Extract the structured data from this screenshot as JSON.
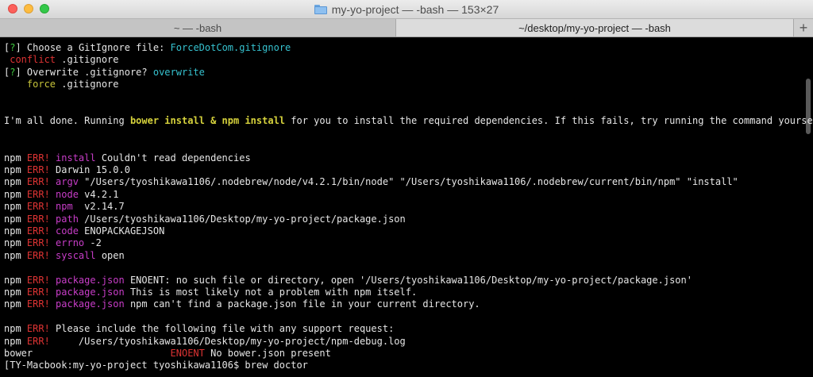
{
  "window": {
    "title": "my-yo-project — -bash — 153×27",
    "tabs": [
      {
        "label": "~ — -bash"
      },
      {
        "label": "~/desktop/my-yo-project — -bash"
      }
    ],
    "add_tab_label": "+"
  },
  "colors": {
    "cyan": "#36c2cf",
    "magenta": "#c83dc8",
    "red": "#dd3333",
    "yellow": "#c7c43a",
    "green": "#3fc83f"
  },
  "terminal": {
    "lines": [
      [
        [
          "[",
          "default"
        ],
        [
          "?",
          "green"
        ],
        [
          "] Choose a GitIgnore file: ",
          "default"
        ],
        [
          "ForceDotCom.gitignore",
          "cyan"
        ]
      ],
      [
        [
          " conflict",
          "red"
        ],
        [
          " .gitignore",
          "default"
        ]
      ],
      [
        [
          "[",
          "default"
        ],
        [
          "?",
          "green"
        ],
        [
          "] Overwrite .gitignore? ",
          "default"
        ],
        [
          "overwrite",
          "cyan"
        ]
      ],
      [
        [
          "    force",
          "yellow"
        ],
        [
          " .gitignore",
          "default"
        ]
      ],
      [],
      [],
      [
        [
          "I'm all done. Running ",
          "default"
        ],
        [
          "bower install & npm install",
          "yellowb"
        ],
        [
          " for you to install the required dependencies. If this fails, try running the command yourself.",
          "default"
        ]
      ],
      [],
      [],
      [
        [
          "npm ",
          "default"
        ],
        [
          "ERR!",
          "red"
        ],
        [
          " install",
          "magenta"
        ],
        [
          " Couldn't read dependencies",
          "default"
        ]
      ],
      [
        [
          "npm ",
          "default"
        ],
        [
          "ERR!",
          "red"
        ],
        [
          " Darwin 15.0.0",
          "default"
        ]
      ],
      [
        [
          "npm ",
          "default"
        ],
        [
          "ERR!",
          "red"
        ],
        [
          " argv",
          "magenta"
        ],
        [
          " \"/Users/tyoshikawa1106/.nodebrew/node/v4.2.1/bin/node\" \"/Users/tyoshikawa1106/.nodebrew/current/bin/npm\" \"install\"",
          "default"
        ]
      ],
      [
        [
          "npm ",
          "default"
        ],
        [
          "ERR!",
          "red"
        ],
        [
          " node",
          "magenta"
        ],
        [
          " v4.2.1",
          "default"
        ]
      ],
      [
        [
          "npm ",
          "default"
        ],
        [
          "ERR!",
          "red"
        ],
        [
          " npm ",
          "magenta"
        ],
        [
          " v2.14.7",
          "default"
        ]
      ],
      [
        [
          "npm ",
          "default"
        ],
        [
          "ERR!",
          "red"
        ],
        [
          " path",
          "magenta"
        ],
        [
          " /Users/tyoshikawa1106/Desktop/my-yo-project/package.json",
          "default"
        ]
      ],
      [
        [
          "npm ",
          "default"
        ],
        [
          "ERR!",
          "red"
        ],
        [
          " code",
          "magenta"
        ],
        [
          " ENOPACKAGEJSON",
          "default"
        ]
      ],
      [
        [
          "npm ",
          "default"
        ],
        [
          "ERR!",
          "red"
        ],
        [
          " errno",
          "magenta"
        ],
        [
          " -2",
          "default"
        ]
      ],
      [
        [
          "npm ",
          "default"
        ],
        [
          "ERR!",
          "red"
        ],
        [
          " syscall",
          "magenta"
        ],
        [
          " open",
          "default"
        ]
      ],
      [],
      [
        [
          "npm ",
          "default"
        ],
        [
          "ERR!",
          "red"
        ],
        [
          " package.json",
          "magenta"
        ],
        [
          " ENOENT: no such file or directory, open '/Users/tyoshikawa1106/Desktop/my-yo-project/package.json'",
          "default"
        ]
      ],
      [
        [
          "npm ",
          "default"
        ],
        [
          "ERR!",
          "red"
        ],
        [
          " package.json",
          "magenta"
        ],
        [
          " This is most likely not a problem with npm itself.",
          "default"
        ]
      ],
      [
        [
          "npm ",
          "default"
        ],
        [
          "ERR!",
          "red"
        ],
        [
          " package.json",
          "magenta"
        ],
        [
          " npm can't find a package.json file in your current directory.",
          "default"
        ]
      ],
      [],
      [
        [
          "npm ",
          "default"
        ],
        [
          "ERR!",
          "red"
        ],
        [
          " Please include the following file with any support request:",
          "default"
        ]
      ],
      [
        [
          "npm ",
          "default"
        ],
        [
          "ERR!",
          "red"
        ],
        [
          "     /Users/tyoshikawa1106/Desktop/my-yo-project/npm-debug.log",
          "default"
        ]
      ],
      [
        [
          "bower                        ",
          "default"
        ],
        [
          "ENOENT",
          "red"
        ],
        [
          " No bower.json present",
          "default"
        ]
      ],
      [
        [
          "[TY-Macbook:my-yo-project tyoshikawa1106$ brew doctor",
          "default"
        ]
      ]
    ]
  }
}
